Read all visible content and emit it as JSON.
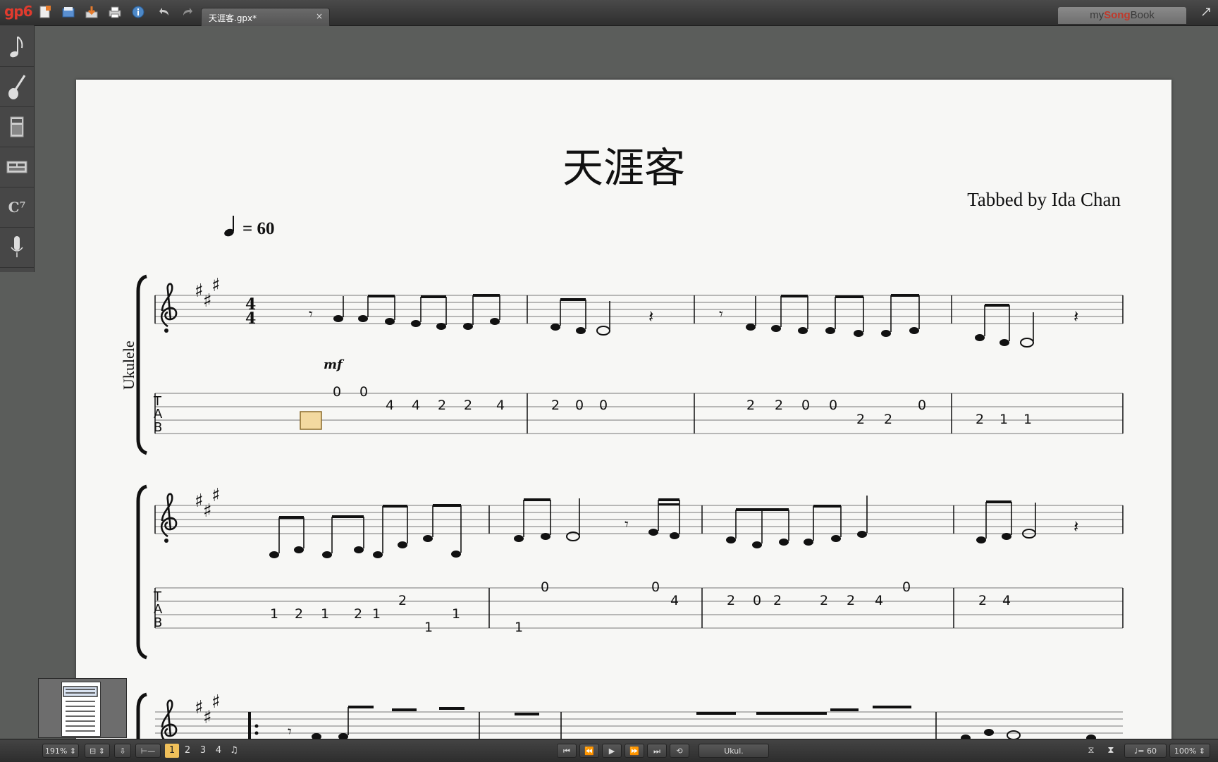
{
  "app": {
    "logo": "gp6",
    "document_tab": "天涯客.gpx*",
    "close_glyph": "×",
    "mysongbook_prefix": "my",
    "mysongbook_brand": "Song",
    "mysongbook_suffix": "Book"
  },
  "toolbar": {
    "icons": [
      "new-file-icon",
      "open-file-icon",
      "import-icon",
      "print-icon",
      "info-icon",
      "undo-icon",
      "redo-icon"
    ]
  },
  "sidebar": {
    "items": [
      "note-icon",
      "guitar-icon",
      "amplifier-icon",
      "mixer-icon",
      "chord-icon",
      "microphone-icon"
    ],
    "chord_label": "C⁷"
  },
  "score": {
    "title": "天涯客",
    "subtitle": "Tabbed by Ida Chan",
    "tempo": "= 60",
    "track_name": "Ukulele",
    "dynamic": "mf",
    "tab_letters": [
      "T",
      "A",
      "B"
    ],
    "time_signature": "4",
    "staff1_tab": {
      "row1": [
        "0",
        "0"
      ],
      "row2": [
        "4",
        "4",
        "2",
        "2",
        "4",
        "2",
        "0",
        "0",
        "2",
        "2",
        "0",
        "0",
        "0"
      ],
      "row3": [
        "2",
        "2",
        "2",
        "1",
        "1"
      ]
    },
    "staff2_tab": {
      "row1": [
        "0",
        "0",
        "0"
      ],
      "row2": [
        "2",
        "4",
        "2",
        "0",
        "2",
        "2",
        "2",
        "4",
        "2",
        "4"
      ],
      "row3": [
        "1",
        "2",
        "1",
        "2",
        "1",
        "1"
      ],
      "row4": [
        "1",
        "1"
      ]
    },
    "staff2_extra_2": "2"
  },
  "statusbar": {
    "zoom": "191%",
    "pages": [
      "1",
      "2",
      "3",
      "4"
    ],
    "current_page": "1",
    "track_label": "Ukul.",
    "tempo_readout": "♩= 60",
    "volume": "100%"
  },
  "colors": {
    "accent_logo": "#e23b2e",
    "selection_cursor": "#f3d9a0",
    "page_bg": "#f7f7f5",
    "workspace_bg": "#5b5d5b"
  }
}
